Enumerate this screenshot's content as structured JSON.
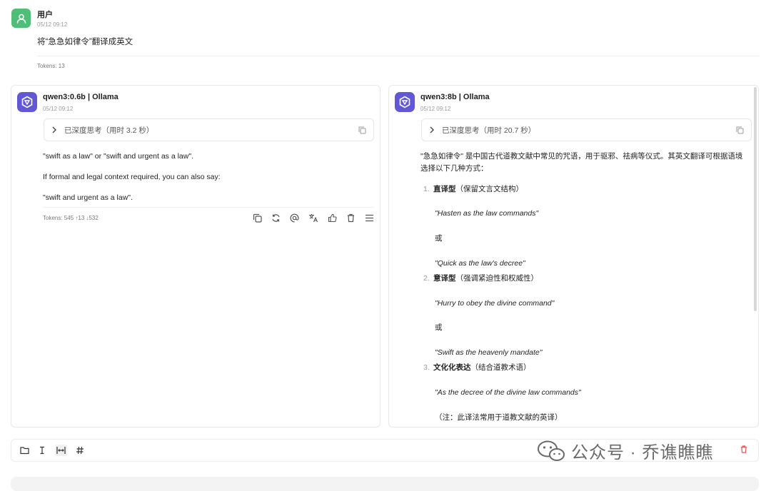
{
  "user": {
    "name": "用户",
    "time": "05/12 09:12",
    "message": "将“急急如律令”翻译成英文",
    "tokens": "Tokens: 13"
  },
  "left": {
    "model": "qwen3:0.6b | Ollama",
    "time": "05/12 09:12",
    "think": "已深度思考（用时 3.2 秒）",
    "p1": "\"swift as a law\" or \"swift and urgent as a law\".",
    "p2": "If formal and legal context required, you can also say:",
    "p3": "\"swift and urgent as a law\".",
    "tokens": "Tokens: 545 ↑13 ↓532"
  },
  "right": {
    "model": "qwen3:8b | Ollama",
    "time": "05/12 09:12",
    "think": "已深度思考（用时 20.7 秒）",
    "intro": "\"急急如律令\" 是中国古代道教文献中常见的咒语，用于驱邪、祛病等仪式。其英文翻译可根据语境选择以下几种方式：",
    "items": [
      {
        "num": "1.",
        "title": "直译型",
        "note": "（保留文言文结构）",
        "a": "\"Hasten as the law commands\"",
        "or": "或",
        "b": "\"Quick as the law's decree\""
      },
      {
        "num": "2.",
        "title": "意译型",
        "note": "（强调紧迫性和权威性）",
        "a": "\"Hurry to obey the divine command\"",
        "or": "或",
        "b": "\"Swift as the heavenly mandate\""
      },
      {
        "num": "3.",
        "title": "文化化表达",
        "note": "（结合道教术语）",
        "a": "\"As the decree of the divine law commands\"",
        "c": "（注：此译法常用于道教文献的英译）"
      }
    ]
  },
  "watermark": "公众号 · 乔谯瞧瞧",
  "colors": {
    "user_avatar": "#4fbe79",
    "model_avatar": "#6258d6"
  }
}
